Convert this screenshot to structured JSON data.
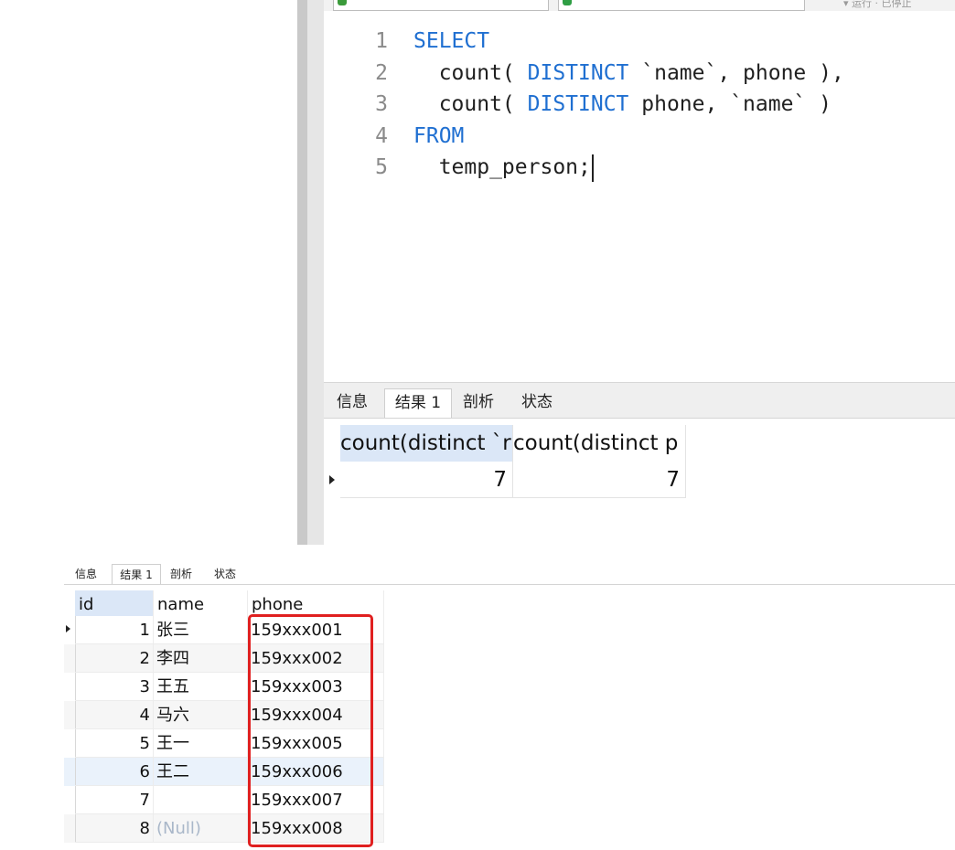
{
  "top_window": {
    "toolbar_fragment": "▾ 运行 · 已停止",
    "editor": {
      "lines": [
        {
          "num": "1",
          "parts": [
            {
              "t": "SELECT",
              "kw": true
            }
          ]
        },
        {
          "num": "2",
          "parts": [
            {
              "t": "  count( ",
              "kw": false
            },
            {
              "t": "DISTINCT",
              "kw": true
            },
            {
              "t": " `name`, phone ),",
              "kw": false
            }
          ]
        },
        {
          "num": "3",
          "parts": [
            {
              "t": "  count( ",
              "kw": false
            },
            {
              "t": "DISTINCT",
              "kw": true
            },
            {
              "t": " phone, `name` )",
              "kw": false
            }
          ]
        },
        {
          "num": "4",
          "parts": [
            {
              "t": "FROM",
              "kw": true
            }
          ]
        },
        {
          "num": "5",
          "parts": [
            {
              "t": "  temp_person;",
              "kw": false
            }
          ]
        }
      ]
    },
    "tabs": [
      "信息",
      "结果 1",
      "剖析",
      "状态"
    ],
    "active_tab": "结果 1",
    "result": {
      "columns": [
        "count(distinct `r",
        "count(distinct p"
      ],
      "values": [
        "7",
        "7"
      ]
    }
  },
  "bottom_window": {
    "tabs": [
      "信息",
      "结果 1",
      "剖析",
      "状态"
    ],
    "columns": [
      "id",
      "name",
      "phone"
    ],
    "rows": [
      {
        "id": "1",
        "name": "张三",
        "phone": "159xxx001"
      },
      {
        "id": "2",
        "name": "李四",
        "phone": "159xxx002"
      },
      {
        "id": "3",
        "name": "王五",
        "phone": "159xxx003"
      },
      {
        "id": "4",
        "name": "马六",
        "phone": "159xxx004"
      },
      {
        "id": "5",
        "name": "王一",
        "phone": "159xxx005"
      },
      {
        "id": "6",
        "name": "王二",
        "phone": "159xxx006"
      },
      {
        "id": "7",
        "name": "",
        "phone": "159xxx007"
      },
      {
        "id": "8",
        "name": "(Null)",
        "phone": "159xxx008"
      }
    ]
  },
  "colors": {
    "keyword": "#1f6fd1",
    "highlight_box": "#e02020",
    "selected_header": "#dbe7f7",
    "null_text": "#a9b7c9"
  }
}
